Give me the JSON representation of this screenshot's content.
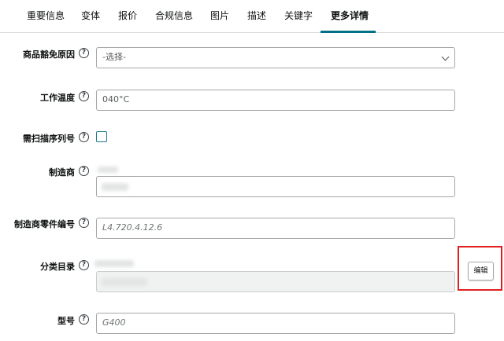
{
  "tabs": [
    {
      "label": "重要信息"
    },
    {
      "label": "变体"
    },
    {
      "label": "报价"
    },
    {
      "label": "合规信息"
    },
    {
      "label": "图片"
    },
    {
      "label": "描述"
    },
    {
      "label": "关键字"
    },
    {
      "label": "更多详情"
    }
  ],
  "active_tab_index": 7,
  "help_icon_glyph": "?",
  "form": {
    "exemption_reason": {
      "label": "商品豁免原因",
      "value": "-选择-"
    },
    "working_temperature": {
      "label": "工作温度",
      "value": "040°C"
    },
    "serial_scan": {
      "label": "需扫描序列号",
      "checked": false
    },
    "manufacturer": {
      "label": "制造商"
    },
    "part_number": {
      "label": "制造商零件编号",
      "placeholder": "L4.720.4.12.6"
    },
    "category": {
      "label": "分类目录",
      "edit_label": "编辑"
    },
    "model": {
      "label": "型号",
      "placeholder": "G400"
    }
  },
  "colors": {
    "active_tab_underline": "#007185",
    "highlight_box": "#e02020",
    "checkbox_border": "#1f7b8a"
  }
}
